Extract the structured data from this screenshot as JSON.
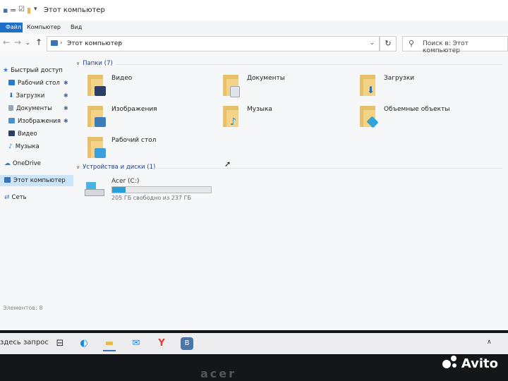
{
  "window": {
    "title": "Этот компьютер",
    "quick_access_separator": "=",
    "quick_access_dropdown": "▾"
  },
  "ribbon": {
    "tabs": [
      {
        "label": "Файл"
      },
      {
        "label": "Компьютер"
      },
      {
        "label": "Вид"
      }
    ]
  },
  "address": {
    "crumb": "Этот компьютер",
    "separator": "›",
    "dropdown": "⌄",
    "refresh_glyph": "↻",
    "search_placeholder": "Поиск в: Этот компьютер"
  },
  "nav": {
    "back": "←",
    "forward": "→",
    "recent": "⌄",
    "up": "↑",
    "items": [
      {
        "label": "Быстрый доступ",
        "icon": "star-icon",
        "color": "#3a7bd5",
        "pinned": false
      },
      {
        "label": "Рабочий стол",
        "icon": "desktop-icon",
        "color": "#2b79c8",
        "pinned": true
      },
      {
        "label": "Загрузки",
        "icon": "download-icon",
        "color": "#2b6cb7",
        "pinned": true
      },
      {
        "label": "Документы",
        "icon": "document-icon",
        "color": "#9aa4b0",
        "pinned": true
      },
      {
        "label": "Изображения",
        "icon": "pictures-icon",
        "color": "#4a90c9",
        "pinned": true
      },
      {
        "label": "Видео",
        "icon": "video-icon",
        "color": "#2c3e66",
        "pinned": false
      },
      {
        "label": "Музыка",
        "icon": "music-icon",
        "color": "#3585c6",
        "pinned": false
      },
      {
        "label": "OneDrive",
        "icon": "cloud-icon",
        "color": "#2f80d1",
        "pinned": false
      },
      {
        "label": "Этот компьютер",
        "icon": "computer-icon",
        "color": "#3a73b8",
        "pinned": false,
        "selected": true
      },
      {
        "label": "Сеть",
        "icon": "network-icon",
        "color": "#3a73b8",
        "pinned": false
      }
    ],
    "pin_glyph": "📌"
  },
  "content": {
    "folders_group": {
      "label": "Папки (7)",
      "chevron": "∨"
    },
    "folders": [
      {
        "label": "Видео",
        "glyph_color": "#2c3e66"
      },
      {
        "label": "Документы",
        "glyph_color": "#dfe5ea"
      },
      {
        "label": "Загрузки",
        "glyph_color": "#2b6cb7"
      },
      {
        "label": "Изображения",
        "glyph_color": "#3d7cb8"
      },
      {
        "label": "Музыка",
        "glyph_color": "#2d8cd6"
      },
      {
        "label": "Объемные объекты",
        "glyph_color": "#34a3d9"
      },
      {
        "label": "Рабочий стол",
        "glyph_color": "#3aa0dc"
      }
    ],
    "drives_group": {
      "label": "Устройства и диски (1)",
      "chevron": "∨"
    },
    "drive": {
      "name": "Acer (C:)",
      "free_text": "205 ГБ свободно из 237 ГБ",
      "used_fraction": 0.135
    }
  },
  "status": {
    "text": "Элементов: 8"
  },
  "taskbar": {
    "search_text": "здесь запрос",
    "icons": [
      {
        "name": "task-view-icon",
        "glyph": "⊟",
        "color": "#333333"
      },
      {
        "name": "edge-icon",
        "glyph": "◐",
        "color": "#1a8ad4"
      },
      {
        "name": "file-explorer-icon",
        "glyph": "▬",
        "color": "#e7b84c"
      },
      {
        "name": "mail-icon",
        "glyph": "✉",
        "color": "#2a7fd4"
      },
      {
        "name": "yandex-browser-icon",
        "glyph": "Y",
        "color": "#e53935"
      },
      {
        "name": "vk-icon",
        "glyph": "В",
        "color": "#4a76a8"
      }
    ],
    "tray_chevron": "∧"
  },
  "bezel": {
    "brand": "acer"
  },
  "watermark": {
    "text": "Avito"
  }
}
